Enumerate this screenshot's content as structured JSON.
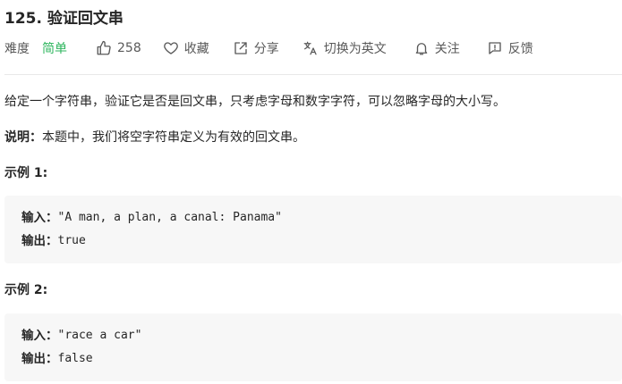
{
  "problem": {
    "title": "125. 验证回文串"
  },
  "meta": {
    "difficulty_label": "难度",
    "difficulty_value": "简单",
    "likes": "258",
    "favorite_label": "收藏",
    "share_label": "分享",
    "translate_label": "切换为英文",
    "follow_label": "关注",
    "feedback_label": "反馈",
    "icons": [
      "thumbs-up-icon",
      "heart-icon",
      "share-icon",
      "translate-icon",
      "bell-icon",
      "feedback-icon"
    ]
  },
  "colors": {
    "easy": "#2db55d",
    "code_bg": "#f7f7f7",
    "text": "#262626",
    "meta_text": "#595959"
  },
  "description": {
    "text": "给定一个字符串，验证它是否是回文串，只考虑字母和数字字符，可以忽略字母的大小写。",
    "note_label": "说明：",
    "note_text": "本题中，我们将空字符串定义为有效的回文串。"
  },
  "examples": [
    {
      "heading": "示例 1:",
      "input_label": "输入：",
      "input_value": "\"A man, a plan, a canal: Panama\"",
      "output_label": "输出：",
      "output_value": "true"
    },
    {
      "heading": "示例 2:",
      "input_label": "输入：",
      "input_value": "\"race a car\"",
      "output_label": "输出：",
      "output_value": "false"
    }
  ]
}
